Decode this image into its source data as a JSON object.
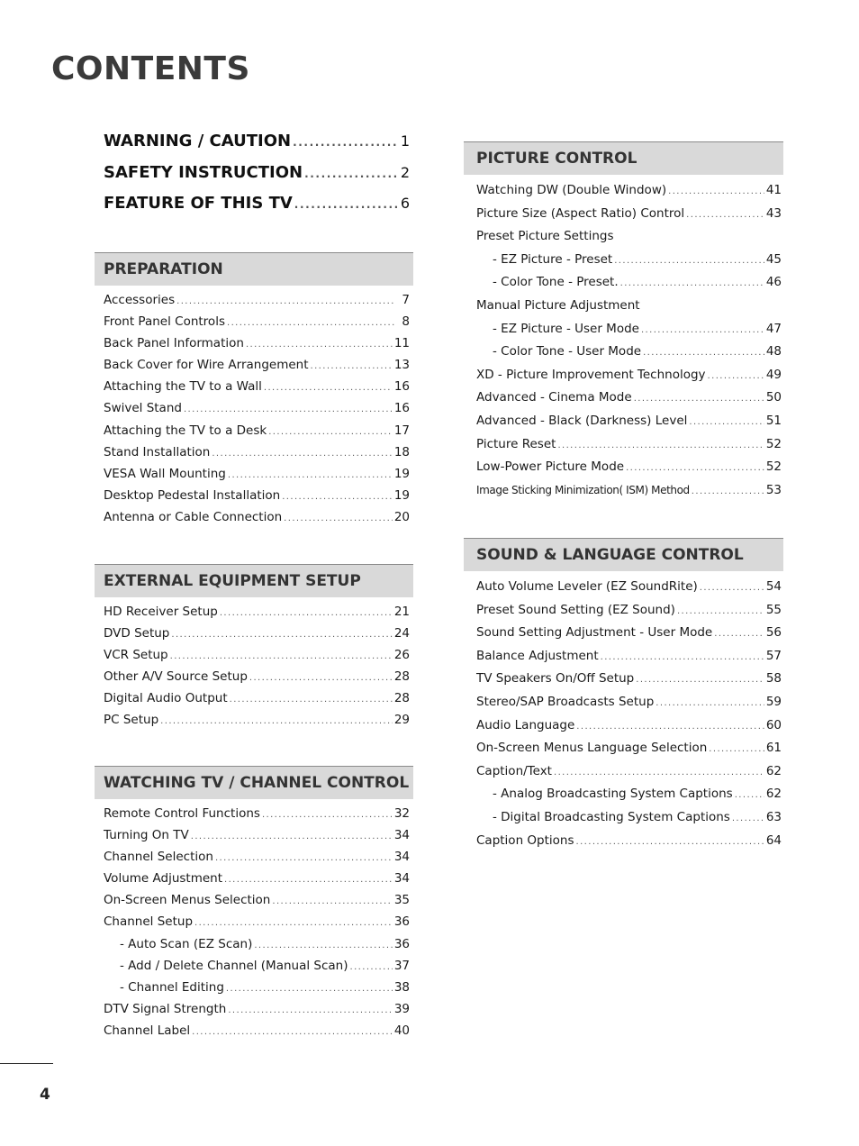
{
  "title": "CONTENTS",
  "top_entries": [
    {
      "label": "WARNING / CAUTION",
      "page": "1"
    },
    {
      "label": "SAFETY INSTRUCTION",
      "page": "2"
    },
    {
      "label": "FEATURE OF THIS TV",
      "page": "6"
    }
  ],
  "sections": {
    "preparation": {
      "title": "PREPARATION",
      "items": [
        {
          "label": "Accessories",
          "page": "7"
        },
        {
          "label": "Front Panel Controls",
          "page": "8"
        },
        {
          "label": "Back Panel Information",
          "page": "11"
        },
        {
          "label": "Back Cover for Wire Arrangement",
          "page": "13"
        },
        {
          "label": "Attaching the TV to a Wall",
          "page": "16"
        },
        {
          "label": "Swivel Stand",
          "page": "16"
        },
        {
          "label": "Attaching the TV to a Desk",
          "page": "17"
        },
        {
          "label": "Stand Installation",
          "page": "18"
        },
        {
          "label": "VESA Wall Mounting",
          "page": "19"
        },
        {
          "label": "Desktop Pedestal Installation",
          "page": "19"
        },
        {
          "label": "Antenna or Cable Connection",
          "page": "20"
        }
      ]
    },
    "external": {
      "title": "EXTERNAL EQUIPMENT SETUP",
      "items": [
        {
          "label": "HD Receiver Setup",
          "page": "21"
        },
        {
          "label": "DVD Setup",
          "page": "24"
        },
        {
          "label": "VCR Setup",
          "page": "26"
        },
        {
          "label": "Other A/V Source Setup",
          "page": "28"
        },
        {
          "label": "Digital Audio Output",
          "page": "28"
        },
        {
          "label": "PC Setup",
          "page": "29"
        }
      ]
    },
    "watching": {
      "title": "WATCHING TV / CHANNEL CONTROL",
      "items": [
        {
          "label": "Remote Control Functions",
          "page": "32"
        },
        {
          "label": "Turning On TV",
          "page": "34"
        },
        {
          "label": "Channel Selection",
          "page": "34"
        },
        {
          "label": "Volume Adjustment",
          "page": "34"
        },
        {
          "label": "On-Screen Menus Selection",
          "page": "35"
        },
        {
          "label": "Channel Setup",
          "page": "36"
        },
        {
          "label": "- Auto Scan (EZ Scan)",
          "page": "36"
        },
        {
          "label": "- Add / Delete Channel (Manual Scan)",
          "page": "37"
        },
        {
          "label": "- Channel Editing",
          "page": "38"
        },
        {
          "label": "DTV Signal Strength",
          "page": "39"
        },
        {
          "label": "Channel Label",
          "page": "40"
        }
      ]
    },
    "picture": {
      "title": "PICTURE CONTROL",
      "items": [
        {
          "label": "Watching DW (Double Window)",
          "page": "41"
        },
        {
          "label": "Picture Size (Aspect Ratio) Control",
          "page": "43"
        },
        {
          "label": "Preset Picture Settings",
          "page": ""
        },
        {
          "label": "- EZ Picture - Preset",
          "page": "45"
        },
        {
          "label": "- Color Tone - Preset.",
          "page": "46"
        },
        {
          "label": "Manual Picture Adjustment",
          "page": ""
        },
        {
          "label": "- EZ Picture - User Mode",
          "page": "47"
        },
        {
          "label": "- Color Tone - User Mode",
          "page": "48"
        },
        {
          "label": "XD - Picture Improvement Technology",
          "page": "49"
        },
        {
          "label": "Advanced - Cinema Mode",
          "page": "50"
        },
        {
          "label": "Advanced - Black (Darkness) Level",
          "page": "51"
        },
        {
          "label": "Picture Reset",
          "page": "52"
        },
        {
          "label": "Low-Power Picture Mode",
          "page": "52"
        },
        {
          "label": "Image Sticking Minimization( ISM) Method",
          "page": "53"
        }
      ]
    },
    "sound": {
      "title": "SOUND & LANGUAGE CONTROL",
      "items": [
        {
          "label": "Auto Volume Leveler (EZ SoundRite)",
          "page": "54"
        },
        {
          "label": "Preset Sound Setting (EZ Sound)",
          "page": "55"
        },
        {
          "label": "Sound Setting Adjustment - User Mode",
          "page": "56"
        },
        {
          "label": "Balance Adjustment",
          "page": "57"
        },
        {
          "label": "TV Speakers On/Off Setup",
          "page": "58"
        },
        {
          "label": "Stereo/SAP Broadcasts Setup",
          "page": "59"
        },
        {
          "label": "Audio Language",
          "page": "60"
        },
        {
          "label": "On-Screen Menus Language Selection",
          "page": "61"
        },
        {
          "label": "Caption/Text",
          "page": "62"
        },
        {
          "label": "- Analog Broadcasting System Captions",
          "page": "62"
        },
        {
          "label": "- Digital Broadcasting System Captions",
          "page": "63"
        },
        {
          "label": "Caption Options",
          "page": "64"
        }
      ]
    }
  },
  "footer": {
    "page_number": "4"
  },
  "colors": {
    "header_bg": "#d9d9d9",
    "header_border": "#8a8a8a",
    "header_text": "#333333"
  }
}
